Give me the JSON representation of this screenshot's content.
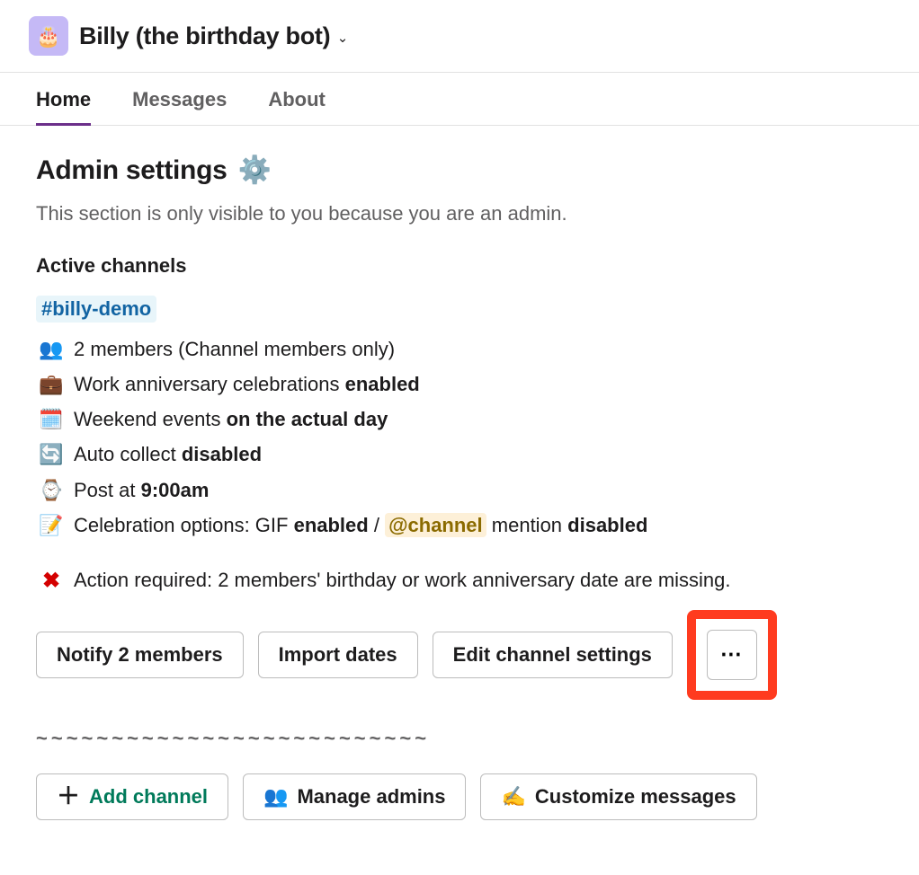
{
  "header": {
    "app_title": "Billy (the birthday bot)"
  },
  "tabs": {
    "home": "Home",
    "messages": "Messages",
    "about": "About"
  },
  "admin": {
    "title": "Admin settings",
    "subtitle": "This section is only visible to you because you are an admin.",
    "active_channels_label": "Active channels",
    "channel_link": "#billy-demo",
    "members_prefix": "2 members ",
    "members_suffix": "(Channel members only)",
    "anniv_prefix": "Work anniversary celebrations ",
    "anniv_status": "enabled",
    "weekend_prefix": "Weekend events ",
    "weekend_status": "on the actual day",
    "auto_prefix": "Auto collect ",
    "auto_status": "disabled",
    "post_prefix": "Post at ",
    "post_time": "9:00am",
    "celeb_prefix": "Celebration options: GIF ",
    "celeb_gif_status": "enabled",
    "celeb_sep": " / ",
    "celeb_at_channel": "@channel",
    "celeb_mention": " mention ",
    "celeb_mention_status": "disabled",
    "action_required": "Action required: 2 members' birthday or work anniversary date are missing.",
    "btn_notify": "Notify 2 members",
    "btn_import": "Import dates",
    "btn_edit_channel": "Edit channel settings",
    "btn_more": "⋯",
    "divider": "~~~~~~~~~~~~~~~~~~~~~~~~~~",
    "btn_add_channel": "Add channel",
    "btn_manage_admins": "Manage admins",
    "btn_customize": "Customize messages"
  }
}
